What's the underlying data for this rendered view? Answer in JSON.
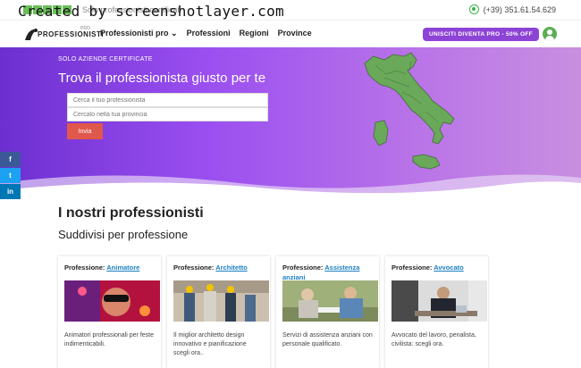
{
  "watermark": "Created by screenshotlayer.com",
  "topbar": {
    "note": "Solo professionisti certificati",
    "phone": "(+39) 351.61.54.629"
  },
  "nav": {
    "logo_text": "PROFESSIONISTI",
    "logo_sub": "PRO",
    "items": [
      {
        "label": "Professionisti pro ⌄"
      },
      {
        "label": "Professioni"
      },
      {
        "label": "Regioni"
      },
      {
        "label": "Province"
      }
    ],
    "cta": "UNISCITI DIVENTA PRO - 50% OFF"
  },
  "hero": {
    "tag": "SOLO AZIENDE CERTIFICATE",
    "title": "Trova il professionista giusto per te",
    "search_placeholder": "Cerca il tuo professionista",
    "province_placeholder": "Cercalo nella tua provincia",
    "submit": "Invia"
  },
  "social": {
    "fb": "f",
    "tw": "t",
    "in": "in"
  },
  "section": {
    "title": "I nostri professionisti",
    "subtitle": "Suddivisi per professione"
  },
  "cards": [
    {
      "label": "Professione:",
      "link": "Animatore",
      "desc": "Animatori professionali per feste indimenticabili."
    },
    {
      "label": "Professione:",
      "link": "Architetto",
      "desc": "Il miglior architetto design innovativo e pianificazione scegli ora.."
    },
    {
      "label": "Professione:",
      "link": "Assistenza anziani",
      "desc": "Servizi di assistenza anziani con personale qualificato."
    },
    {
      "label": "Professione:",
      "link": "Avvocato",
      "desc": "Avvocato del lavoro, penalista, civilista: scegli ora."
    }
  ],
  "colors": {
    "accent": "#8c43d6",
    "submit": "#e0574b",
    "link": "#1a7fc1",
    "map_green": "#6aa85a"
  }
}
